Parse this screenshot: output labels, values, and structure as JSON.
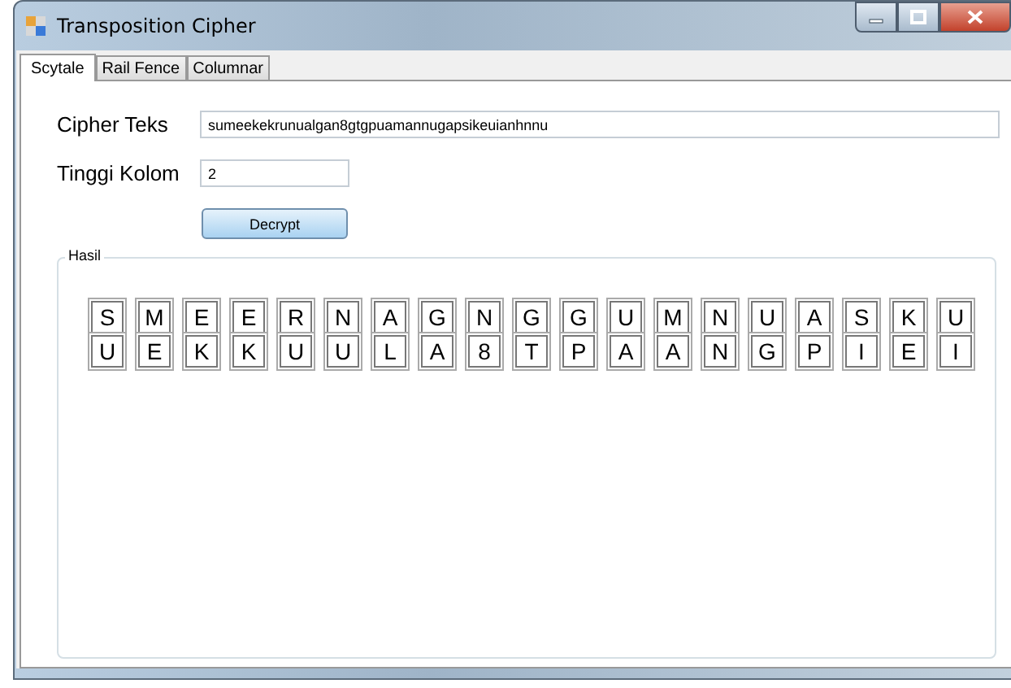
{
  "window": {
    "title": "Transposition Cipher"
  },
  "tabs": [
    {
      "label": "Scytale",
      "selected": true
    },
    {
      "label": "Rail Fence",
      "selected": false
    },
    {
      "label": "Columnar",
      "selected": false
    }
  ],
  "form": {
    "cipher_label": "Cipher Teks",
    "cipher_value": "sumeekekrunualgan8gtgpuamannugapsikeuianhnnu",
    "height_label": "Tinggi Kolom",
    "height_value": "2",
    "button": "Decrypt"
  },
  "result": {
    "title": "Hasil",
    "rows": [
      [
        "S",
        "M",
        "E",
        "E",
        "R",
        "N",
        "A",
        "G",
        "N",
        "G",
        "G",
        "U",
        "M",
        "N",
        "U",
        "A",
        "S",
        "K",
        "U"
      ],
      [
        "U",
        "E",
        "K",
        "K",
        "U",
        "U",
        "L",
        "A",
        "8",
        "T",
        "P",
        "A",
        "A",
        "N",
        "G",
        "P",
        "I",
        "E",
        "I"
      ]
    ]
  }
}
